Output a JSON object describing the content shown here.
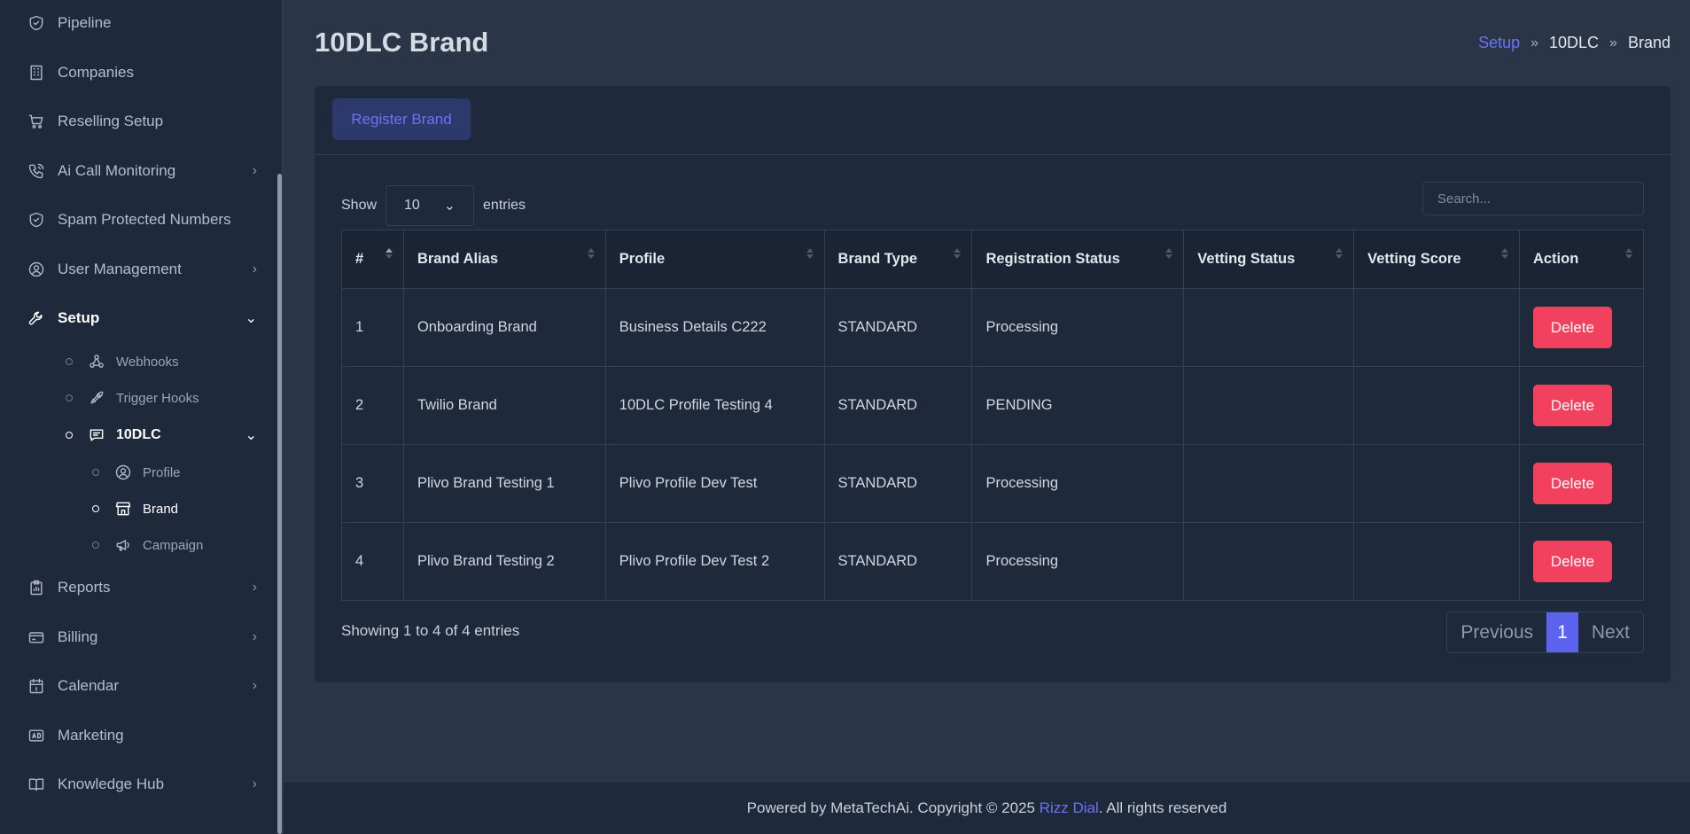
{
  "sidebar": {
    "items": [
      {
        "label": "Pipeline",
        "icon": "shield-icon"
      },
      {
        "label": "Companies",
        "icon": "building-icon"
      },
      {
        "label": "Reselling Setup",
        "icon": "cart-icon"
      },
      {
        "label": "Ai Call Monitoring",
        "icon": "phone-icon"
      },
      {
        "label": "Spam Protected Numbers",
        "icon": "shield-icon"
      },
      {
        "label": "User Management",
        "icon": "user-circle-icon"
      },
      {
        "label": "Setup",
        "icon": "wrench-icon"
      },
      {
        "label": "Reports",
        "icon": "clipboard-icon"
      },
      {
        "label": "Billing",
        "icon": "card-icon"
      },
      {
        "label": "Calendar",
        "icon": "calendar-icon"
      },
      {
        "label": "Marketing",
        "icon": "ad-icon"
      },
      {
        "label": "Knowledge Hub",
        "icon": "book-icon"
      }
    ],
    "setup_sub": [
      {
        "label": "Webhooks",
        "icon": "webhook-icon"
      },
      {
        "label": "Trigger Hooks",
        "icon": "rocket-icon"
      },
      {
        "label": "10DLC",
        "icon": "message-icon"
      }
    ],
    "dlc_sub": [
      {
        "label": "Profile",
        "icon": "user-circle-icon"
      },
      {
        "label": "Brand",
        "icon": "store-icon"
      },
      {
        "label": "Campaign",
        "icon": "megaphone-icon"
      }
    ]
  },
  "header": {
    "title": "10DLC Brand",
    "breadcrumb": [
      "Setup",
      "10DLC",
      "Brand"
    ]
  },
  "toolbar": {
    "register_label": "Register Brand",
    "show_label": "Show",
    "entries_label": "entries",
    "page_length": "10",
    "search_placeholder": "Search..."
  },
  "table": {
    "columns": [
      "#",
      "Brand Alias",
      "Profile",
      "Brand Type",
      "Registration Status",
      "Vetting Status",
      "Vetting Score",
      "Action"
    ],
    "rows": [
      {
        "num": "1",
        "alias": "Onboarding Brand",
        "profile": "Business Details C222",
        "type": "STANDARD",
        "reg": "Processing",
        "vetting": "",
        "score": "",
        "action": "Delete"
      },
      {
        "num": "2",
        "alias": "Twilio Brand",
        "profile": "10DLC Profile Testing 4",
        "type": "STANDARD",
        "reg": "PENDING",
        "vetting": "",
        "score": "",
        "action": "Delete"
      },
      {
        "num": "3",
        "alias": "Plivo Brand Testing 1",
        "profile": "Plivo Profile Dev Test",
        "type": "STANDARD",
        "reg": "Processing",
        "vetting": "",
        "score": "",
        "action": "Delete"
      },
      {
        "num": "4",
        "alias": "Plivo Brand Testing 2",
        "profile": "Plivo Profile Dev Test 2",
        "type": "STANDARD",
        "reg": "Processing",
        "vetting": "",
        "score": "",
        "action": "Delete"
      }
    ]
  },
  "pagination": {
    "info": "Showing 1 to 4 of 4 entries",
    "previous": "Previous",
    "current": "1",
    "next": "Next"
  },
  "footer": {
    "prefix": "Powered by MetaTechAi. Copyright © 2025 ",
    "brand": "Rizz Dial",
    "suffix": ". All rights reserved"
  },
  "colors": {
    "accent": "#5b63ef",
    "danger": "#f2415f",
    "background": "#2a3548",
    "panel": "#1e293b"
  }
}
